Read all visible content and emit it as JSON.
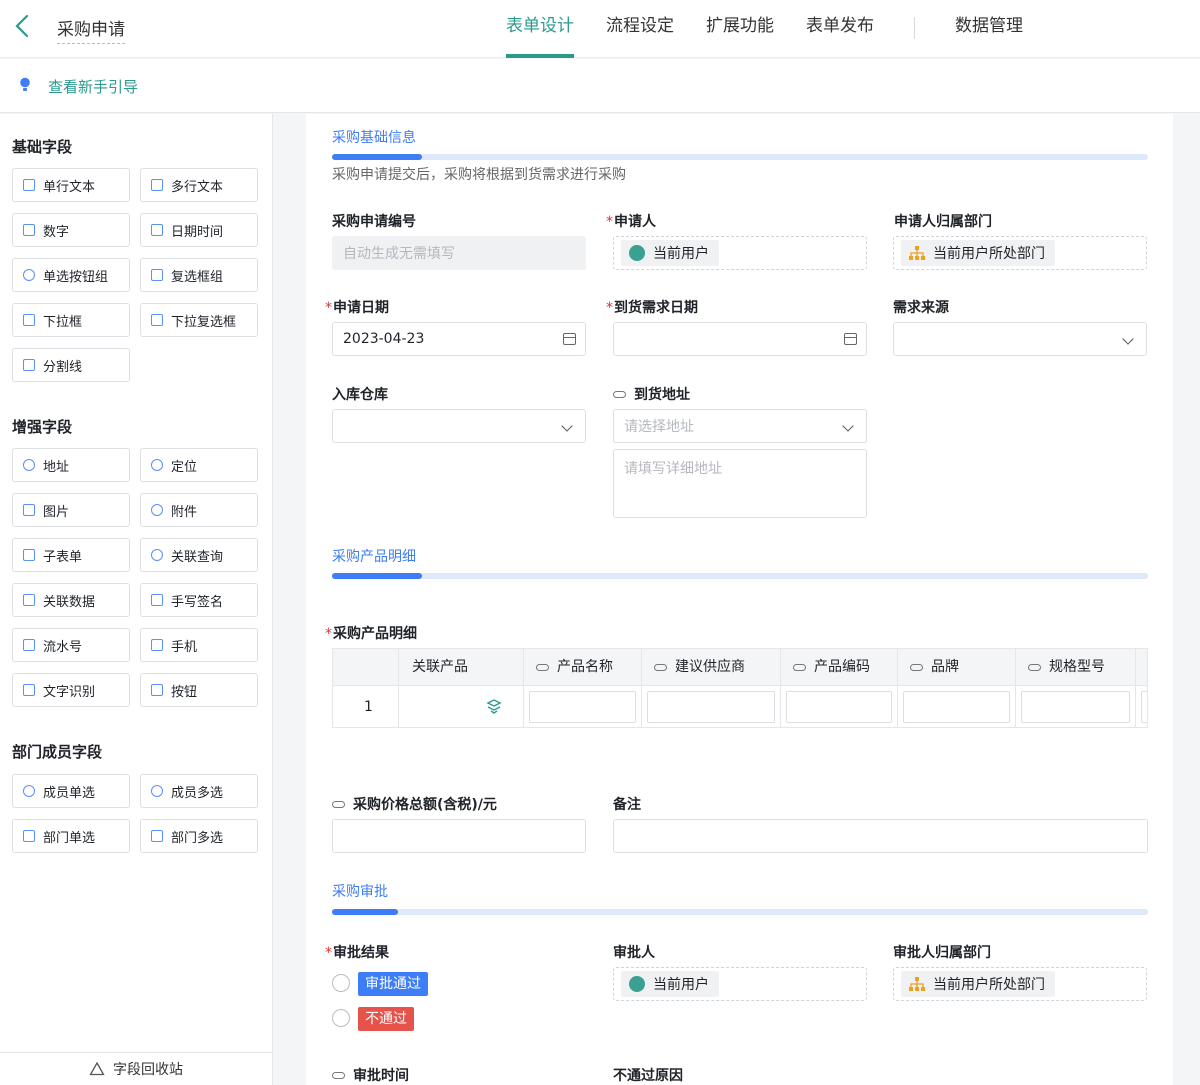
{
  "header": {
    "title": "采购申请",
    "tabs": [
      {
        "label": "表单设计",
        "active": true
      },
      {
        "label": "流程设定"
      },
      {
        "label": "扩展功能"
      },
      {
        "label": "表单发布"
      }
    ],
    "data_tab": "数据管理"
  },
  "guide": {
    "label": "查看新手引导"
  },
  "sidebar": {
    "groups": [
      {
        "title": "基础字段",
        "items": [
          "单行文本",
          "多行文本",
          "数字",
          "日期时间",
          "单选按钮组",
          "复选框组",
          "下拉框",
          "下拉复选框",
          "分割线"
        ]
      },
      {
        "title": "增强字段",
        "items": [
          "地址",
          "定位",
          "图片",
          "附件",
          "子表单",
          "关联查询",
          "关联数据",
          "手写签名",
          "流水号",
          "手机",
          "文字识别",
          "按钮"
        ]
      },
      {
        "title": "部门成员字段",
        "items": [
          "成员单选",
          "成员多选",
          "部门单选",
          "部门多选"
        ]
      }
    ],
    "recycle": "字段回收站"
  },
  "form": {
    "sections": [
      {
        "title": "采购基础信息",
        "desc": "采购申请提交后，采购将根据到货需求进行采购"
      },
      {
        "title": "采购产品明细"
      },
      {
        "title": "采购审批"
      }
    ],
    "fields": {
      "serial": {
        "label": "采购申请编号",
        "placeholder": "自动生成无需填写"
      },
      "applicant": {
        "label": "申请人",
        "value": "当前用户"
      },
      "dept": {
        "label": "申请人归属部门",
        "value": "当前用户所处部门"
      },
      "apply_date": {
        "label": "申请日期",
        "value": "2023-04-23"
      },
      "arrival_date": {
        "label": "到货需求日期"
      },
      "source": {
        "label": "需求来源"
      },
      "warehouse": {
        "label": "入库仓库"
      },
      "address": {
        "label": "到货地址",
        "placeholder": "请选择地址",
        "detail_placeholder": "请填写详细地址"
      },
      "detail_table": {
        "label": "采购产品明细",
        "columns": [
          "关联产品",
          "产品名称",
          "建议供应商",
          "产品编码",
          "品牌",
          "规格型号"
        ],
        "row_index": "1"
      },
      "total": {
        "label": "采购价格总额(含税)/元"
      },
      "remark": {
        "label": "备注"
      },
      "approve_result": {
        "label": "审批结果",
        "options": [
          "审批通过",
          "不通过"
        ]
      },
      "approver": {
        "label": "审批人",
        "value": "当前用户"
      },
      "approver_dept": {
        "label": "审批人归属部门",
        "value": "当前用户所处部门"
      },
      "approve_time": {
        "label": "审批时间"
      },
      "reject_reason": {
        "label": "不通过原因"
      }
    }
  },
  "colors": {
    "accent": "#2b9a8d",
    "section": "#3d7df6",
    "pass": "#3d7df6",
    "fail": "#e5534b",
    "required": "#e03030"
  }
}
